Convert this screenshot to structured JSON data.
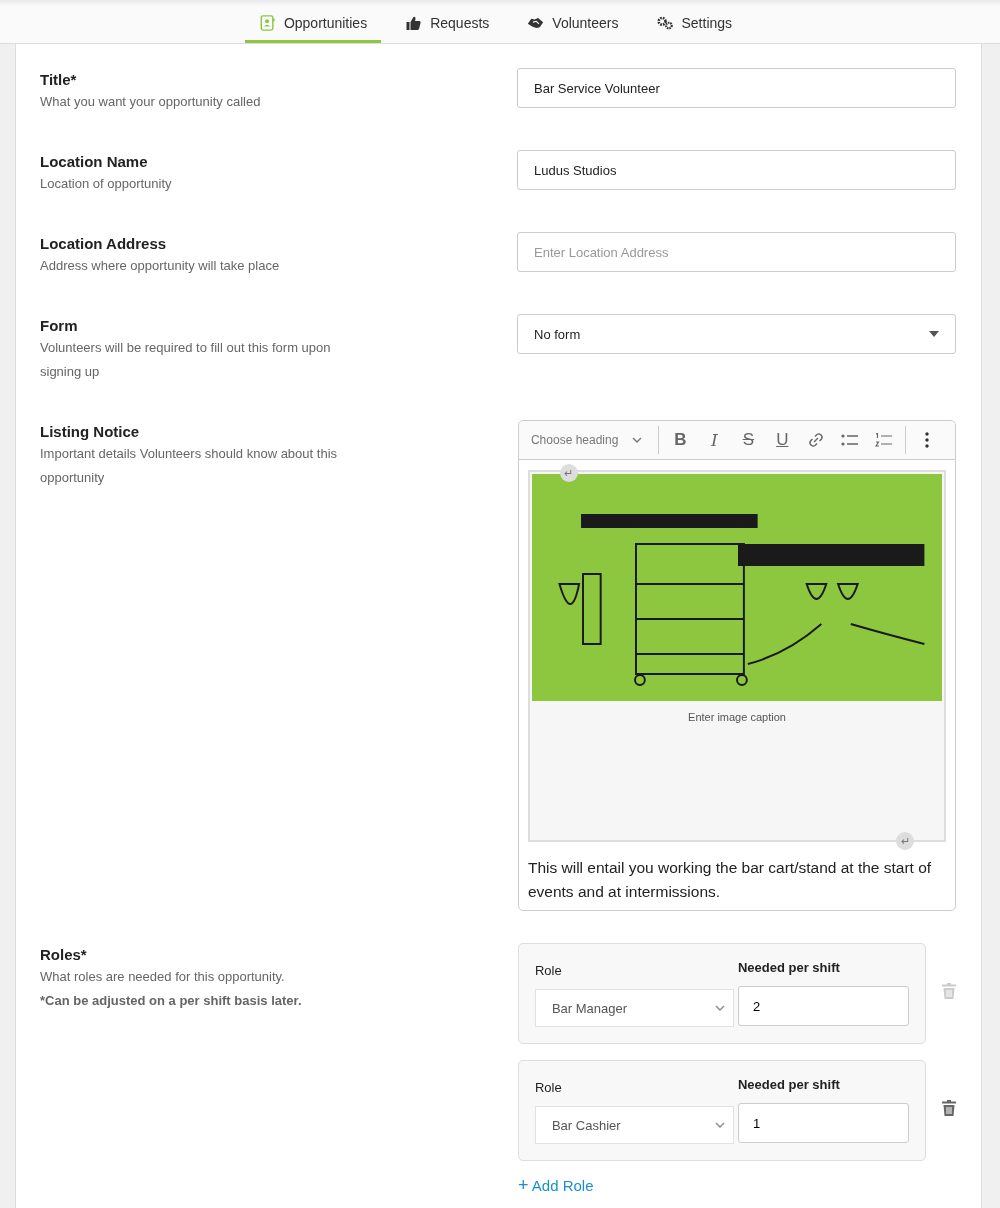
{
  "tabs": [
    {
      "label": "Opportunities",
      "kind": "contact",
      "selected": true
    },
    {
      "label": "Requests",
      "kind": "thumb",
      "selected": false
    },
    {
      "label": "Volunteers",
      "kind": "handshake",
      "selected": false
    },
    {
      "label": "Settings",
      "kind": "gears",
      "selected": false
    }
  ],
  "fields": [
    {
      "kind": "text",
      "title": "Title*",
      "description": "What you want your opportunity called",
      "value": "Bar Service Volunteer"
    },
    {
      "kind": "text",
      "title": "Location Name",
      "description": "Location of opportunity",
      "value": "Ludus Studios"
    },
    {
      "kind": "text",
      "title": "Location Address",
      "description": "Address where opportunity will take place",
      "placeholder": "Enter Location Address"
    },
    {
      "kind": "select",
      "title": "Form",
      "description": "Volunteers will be required to fill out this form upon signing up",
      "value": "No form"
    },
    {
      "kind": "editor",
      "title": "Listing Notice",
      "description": "Important details Volunteers should know about this opportunity"
    }
  ],
  "editor": {
    "heading_select": "Choose heading",
    "toolbar": [
      {
        "kind": "bold",
        "glyph": "B"
      },
      {
        "kind": "italic",
        "glyph": "I"
      },
      {
        "kind": "strike",
        "glyph": "S"
      },
      {
        "kind": "underline",
        "glyph": "U"
      },
      {
        "kind": "link"
      },
      {
        "kind": "bullets"
      },
      {
        "kind": "numbers"
      },
      {
        "kind": "more"
      }
    ],
    "return_mark": "↵",
    "image": {
      "kind": "picture",
      "caption_placeholder": "Enter image caption"
    },
    "paragraph": "This will entail you working the bar cart/stand at the start of events and at intermissions."
  },
  "roles_section": {
    "title": "Roles*",
    "description": "What roles are needed for this opportunity.",
    "note": "*Can be adjusted on a per shift basis later.",
    "roles": [
      {
        "role_label": "Role",
        "needed_label": "Needed per shift",
        "role": "Bar Manager",
        "needed": "2",
        "delete_disabled": true
      },
      {
        "role_label": "Role",
        "needed_label": "Needed per shift",
        "role": "Bar Cashier",
        "needed": "1",
        "delete_disabled": false
      }
    ],
    "add_button": {
      "icon": "+",
      "label": "Add Role"
    }
  }
}
